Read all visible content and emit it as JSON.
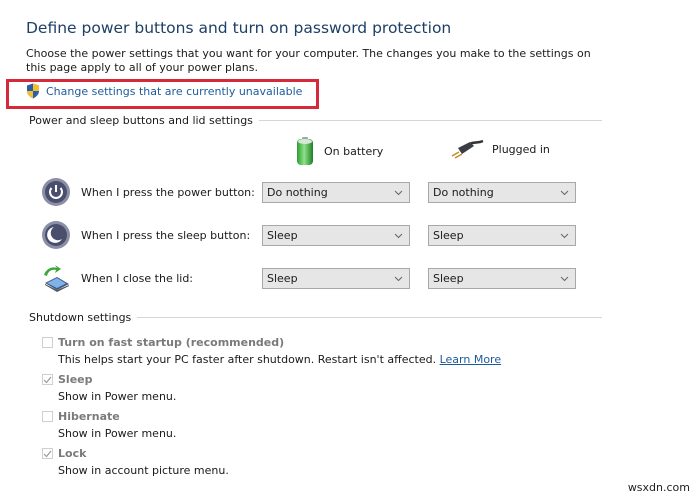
{
  "header": {
    "title": "Define power buttons and turn on password protection",
    "description": "Choose the power settings that you want for your computer. The changes you make to the settings on this page apply to all of your power plans.",
    "change_settings_link": "Change settings that are currently unavailable"
  },
  "power_section": {
    "heading": "Power and sleep buttons and lid settings",
    "columns": [
      {
        "label": "On battery",
        "icon": "battery-icon"
      },
      {
        "label": "Plugged in",
        "icon": "power-plug-icon"
      }
    ],
    "rows": [
      {
        "label": "When I press the power button:",
        "icon": "power-button-icon",
        "on_battery": "Do nothing",
        "plugged_in": "Do nothing"
      },
      {
        "label": "When I press the sleep button:",
        "icon": "sleep-button-icon",
        "on_battery": "Sleep",
        "plugged_in": "Sleep"
      },
      {
        "label": "When I close the lid:",
        "icon": "laptop-lid-icon",
        "on_battery": "Sleep",
        "plugged_in": "Sleep"
      }
    ]
  },
  "shutdown_section": {
    "heading": "Shutdown settings",
    "items": [
      {
        "label": "Turn on fast startup (recommended)",
        "checked": false,
        "description": "This helps start your PC faster after shutdown. Restart isn't affected.",
        "link": "Learn More"
      },
      {
        "label": "Sleep",
        "checked": true,
        "description": "Show in Power menu."
      },
      {
        "label": "Hibernate",
        "checked": false,
        "description": "Show in Power menu."
      },
      {
        "label": "Lock",
        "checked": true,
        "description": "Show in account picture menu."
      }
    ]
  },
  "watermark": "wsxdn.com",
  "colors": {
    "title": "#1e3f66",
    "link": "#1b5c9a",
    "highlight_border": "#d42a3a"
  }
}
